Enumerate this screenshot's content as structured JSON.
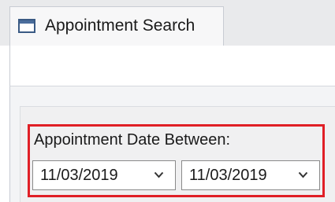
{
  "tabs": [
    {
      "label": "Appointment Search",
      "icon": "window-icon"
    }
  ],
  "filter": {
    "label": "Appointment Date Between:",
    "from_date": "11/03/2019",
    "to_date": "11/03/2019",
    "dropdown_icon": "chevron-down-icon"
  },
  "colors": {
    "highlight_border": "#e01f26",
    "tab_icon": "#3a5a84"
  }
}
